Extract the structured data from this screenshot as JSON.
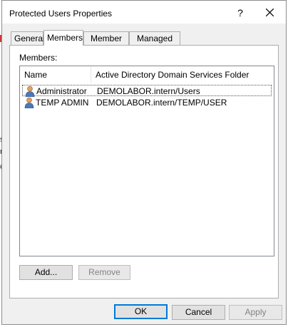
{
  "window": {
    "title": "Protected Users Properties",
    "help_glyph": "?",
    "close_icon": "close-icon"
  },
  "tabs": [
    {
      "label": "General",
      "active": false
    },
    {
      "label": "Members",
      "active": true
    },
    {
      "label": "Member Of",
      "active": false
    },
    {
      "label": "Managed By",
      "active": false
    }
  ],
  "members": {
    "label": "Members:",
    "columns": [
      "Name",
      "Active Directory Domain Services Folder"
    ],
    "rows": [
      {
        "name": "Administrator",
        "folder": "DEMOLABOR.intern/Users",
        "icon": "user-icon",
        "selected": true
      },
      {
        "name": "TEMP ADMIN",
        "folder": "DEMOLABOR.intern/TEMP/USER",
        "icon": "user-icon",
        "selected": false
      }
    ],
    "add_label": "Add...",
    "remove_label": "Remove"
  },
  "footer": {
    "ok_label": "OK",
    "cancel_label": "Cancel",
    "apply_label": "Apply"
  },
  "colors": {
    "accent": "#0078d7",
    "dialog_bg": "#f0f0f0",
    "panel_bg": "#ffffff"
  }
}
